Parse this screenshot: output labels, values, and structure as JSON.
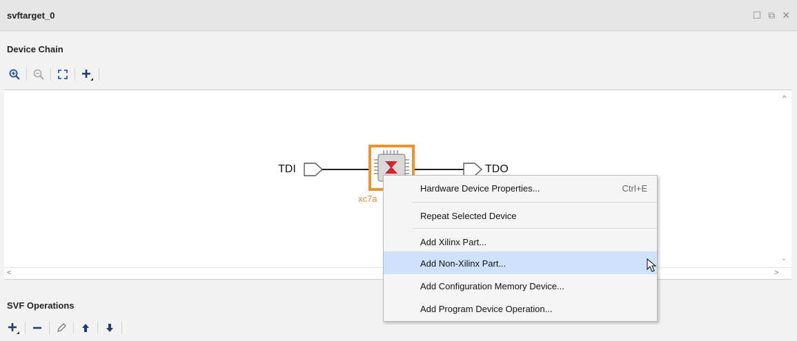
{
  "window": {
    "title": "svftarget_0",
    "controls": [
      "maximize-icon",
      "restore-icon",
      "close-icon"
    ]
  },
  "device_chain": {
    "label": "Device Chain",
    "toolbar": [
      "zoom-in-icon",
      "zoom-out-icon",
      "fit-icon",
      "add-icon"
    ]
  },
  "diagram": {
    "tdi_label": "TDI",
    "tdo_label": "TDO",
    "device_name": "xc7a",
    "highlight_color": "#f0922b"
  },
  "context_menu": {
    "items": [
      {
        "label": "Hardware Device Properties...",
        "shortcut": "Ctrl+E"
      },
      {
        "label": "Repeat Selected Device"
      },
      {
        "label": "Add Xilinx Part..."
      },
      {
        "label": "Add Non-Xilinx Part...",
        "highlighted": true
      },
      {
        "label": "Add Configuration Memory Device..."
      },
      {
        "label": "Add Program Device Operation..."
      }
    ]
  },
  "svf_operations": {
    "label": "SVF Operations",
    "toolbar": [
      "add-icon",
      "remove-icon",
      "edit-icon",
      "move-up-icon",
      "move-down-icon"
    ]
  }
}
